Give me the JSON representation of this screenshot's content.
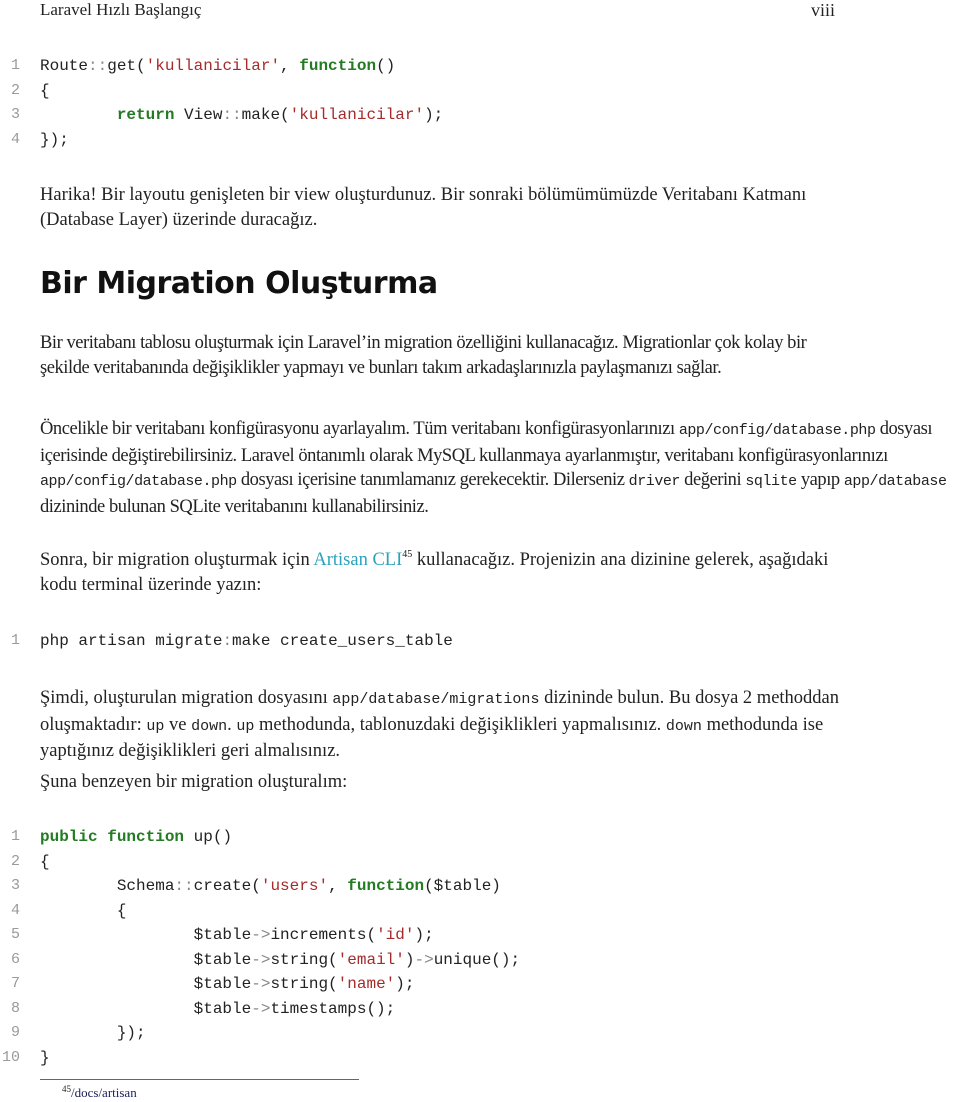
{
  "header": {
    "title": "Laravel Hızlı Başlangıç",
    "page_number": "viii"
  },
  "code_block_1": {
    "lines": [
      {
        "n": "1",
        "parts": [
          {
            "t": "Route",
            "c": ""
          },
          {
            "t": "::",
            "c": "op"
          },
          {
            "t": "get(",
            "c": ""
          },
          {
            "t": "'kullanicilar'",
            "c": "str"
          },
          {
            "t": ", ",
            "c": ""
          },
          {
            "t": "function",
            "c": "kw"
          },
          {
            "t": "()",
            "c": ""
          }
        ]
      },
      {
        "n": "2",
        "parts": [
          {
            "t": "{",
            "c": ""
          }
        ]
      },
      {
        "n": "3",
        "parts": [
          {
            "t": "        ",
            "c": ""
          },
          {
            "t": "return",
            "c": "kw"
          },
          {
            "t": " View",
            "c": ""
          },
          {
            "t": "::",
            "c": "op"
          },
          {
            "t": "make(",
            "c": ""
          },
          {
            "t": "'kullanicilar'",
            "c": "str"
          },
          {
            "t": ");",
            "c": ""
          }
        ]
      },
      {
        "n": "4",
        "parts": [
          {
            "t": "});",
            "c": ""
          }
        ]
      }
    ]
  },
  "para_1": {
    "text": "Harika! Bir layoutu genişleten bir view oluşturdunuz. Bir sonraki bölümümümüzde Veritabanı Katmanı (Database Layer) üzerinde duracağız."
  },
  "section_heading": "Bir Migration Oluşturma",
  "para_2": {
    "text": "Bir veritabanı tablosu oluşturmak için Laravel’in migration özelliğini kullanacağız. Migrationlar çok kolay bir şekilde veritabanında değişiklikler yapmayı ve bunları takım arkadaşlarınızla paylaşmanızı sağlar."
  },
  "para_3": {
    "t1": "Öncelikle bir veritabanı konfigürasyonu ayarlayalım. Tüm veritabanı konfigürasyonlarınızı ",
    "c1": "app/config/database.php",
    "t2": " dosyası içerisinde değiştirebilirsiniz. Laravel öntanımlı olarak MySQL kullanmaya ayarlanmıştır, veritabanı konfigürasyonlarınızı ",
    "c2": "app/config/database.php",
    "t3": " dosyası içerisine tanımlamanız gerekecektir. Dilerseniz ",
    "c3": "driver",
    "t4": " değerini ",
    "c4": "sqlite",
    "t5": " yapıp ",
    "c5": "app/database",
    "t6": " dizininde bulunan SQLite veritabanını kullanabilirsiniz."
  },
  "para_4": {
    "t1": "Sonra, bir migration oluşturmak için ",
    "link": "Artisan CLI",
    "footnote_ref": "45",
    "t2": " kullanacağız. Projenizin ana dizinine gelerek, aşağıdaki kodu terminal üzerinde yazın:"
  },
  "code_block_2": {
    "lines": [
      {
        "n": "1",
        "parts": [
          {
            "t": "php artisan migrate",
            "c": ""
          },
          {
            "t": ":",
            "c": "op"
          },
          {
            "t": "make create_users_table",
            "c": ""
          }
        ]
      }
    ]
  },
  "para_5": {
    "t1": "Şimdi, oluşturulan migration dosyasını ",
    "c1": "app/database/migrations",
    "t2": " dizininde bulun. Bu dosya 2 methoddan oluşmaktadır: ",
    "c2": "up",
    "t3": " ve ",
    "c3": "down",
    "t4": ". ",
    "c4": "up",
    "t5": " methodunda, tablonuzdaki değişiklikleri yapmalısınız. ",
    "c5": "down",
    "t6": " methodunda ise yaptığınız değişiklikleri geri almalısınız."
  },
  "para_6": {
    "text": "Şuna benzeyen bir migration oluşturalım:"
  },
  "code_block_3": {
    "lines": [
      {
        "n": "1",
        "parts": [
          {
            "t": "public",
            "c": "kw"
          },
          {
            "t": " ",
            "c": ""
          },
          {
            "t": "function",
            "c": "kw"
          },
          {
            "t": " up()",
            "c": ""
          }
        ]
      },
      {
        "n": "2",
        "parts": [
          {
            "t": "{",
            "c": ""
          }
        ]
      },
      {
        "n": "3",
        "parts": [
          {
            "t": "        Schema",
            "c": ""
          },
          {
            "t": "::",
            "c": "op"
          },
          {
            "t": "create(",
            "c": ""
          },
          {
            "t": "'users'",
            "c": "str"
          },
          {
            "t": ", ",
            "c": ""
          },
          {
            "t": "function",
            "c": "kw"
          },
          {
            "t": "($table)",
            "c": ""
          }
        ]
      },
      {
        "n": "4",
        "parts": [
          {
            "t": "        {",
            "c": ""
          }
        ]
      },
      {
        "n": "5",
        "parts": [
          {
            "t": "                $table",
            "c": ""
          },
          {
            "t": "->",
            "c": "op"
          },
          {
            "t": "increments(",
            "c": ""
          },
          {
            "t": "'id'",
            "c": "str"
          },
          {
            "t": ");",
            "c": ""
          }
        ]
      },
      {
        "n": "6",
        "parts": [
          {
            "t": "                $table",
            "c": ""
          },
          {
            "t": "->",
            "c": "op"
          },
          {
            "t": "string(",
            "c": ""
          },
          {
            "t": "'email'",
            "c": "str"
          },
          {
            "t": ")",
            "c": ""
          },
          {
            "t": "->",
            "c": "op"
          },
          {
            "t": "unique();",
            "c": ""
          }
        ]
      },
      {
        "n": "7",
        "parts": [
          {
            "t": "                $table",
            "c": ""
          },
          {
            "t": "->",
            "c": "op"
          },
          {
            "t": "string(",
            "c": ""
          },
          {
            "t": "'name'",
            "c": "str"
          },
          {
            "t": ");",
            "c": ""
          }
        ]
      },
      {
        "n": "8",
        "parts": [
          {
            "t": "                $table",
            "c": ""
          },
          {
            "t": "->",
            "c": "op"
          },
          {
            "t": "timestamps();",
            "c": ""
          }
        ]
      },
      {
        "n": "9",
        "parts": [
          {
            "t": "        });",
            "c": ""
          }
        ]
      },
      {
        "n": "10",
        "parts": [
          {
            "t": "}",
            "c": ""
          }
        ]
      }
    ]
  },
  "footnote": {
    "number": "45",
    "text": "/docs/artisan"
  },
  "colors": {
    "keyword": "#237b23",
    "string": "#a52a2a",
    "link": "#2aa2bd",
    "line_number": "#9a9a9a",
    "footnote_text": "#1a1f5c"
  }
}
